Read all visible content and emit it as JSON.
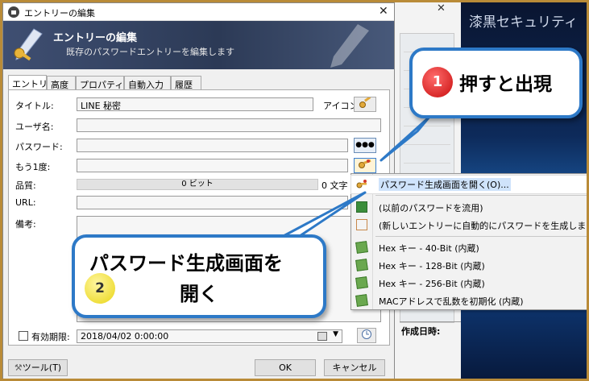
{
  "background_window": {
    "title": "漆黒セキュリティ",
    "close_glyph": "✕",
    "date_label": "作成日時:"
  },
  "dialog": {
    "title": "エントリーの編集",
    "close_glyph": "✕",
    "banner_title": "エントリーの編集",
    "banner_subtitle": "既存のパスワードエントリーを編集します",
    "tabs": [
      "エントリー",
      "高度",
      "プロパティ",
      "自動入力",
      "履歴"
    ],
    "fields": {
      "title_label": "タイトル:",
      "title_value": "LINE 秘密",
      "icon_label": "アイコン:",
      "username_label": "ユーザ名:",
      "username_value": "",
      "password_label": "パスワード:",
      "password_value": "",
      "reveal_glyph": "●●●",
      "repeat_label": "もう1度:",
      "repeat_value": "",
      "quality_label": "品質:",
      "quality_value": "0 ビット",
      "quality_chars": "0 文字",
      "url_label": "URL:",
      "url_value": "",
      "notes_label": "備考:",
      "expires_label": "有効期限:",
      "expires_value": "2018/04/02   0:00:00",
      "expires_checked": false
    },
    "buttons": {
      "tools": "ツール(T)",
      "ok": "OK",
      "cancel": "キャンセル"
    }
  },
  "generator_menu": {
    "items": [
      {
        "label": "パスワード生成画面を開く(O)...",
        "icon": "key-generate-icon",
        "highlighted": true
      },
      {
        "label": "(以前のパスワードを流用)",
        "icon": "history-icon",
        "highlighted": false
      },
      {
        "label": "(新しいエントリーに自動的にパスワードを生成します)",
        "icon": "auto-generate-icon",
        "highlighted": false
      },
      {
        "label": "Hex キー - 40-Bit (内蔵)",
        "icon": "profile-icon",
        "highlighted": false
      },
      {
        "label": "Hex キー - 128-Bit (内蔵)",
        "icon": "profile-icon",
        "highlighted": false
      },
      {
        "label": "Hex キー - 256-Bit (内蔵)",
        "icon": "profile-icon",
        "highlighted": false
      },
      {
        "label": "MACアドレスで乱数を初期化 (内蔵)",
        "icon": "profile-icon",
        "highlighted": false
      }
    ]
  },
  "callouts": {
    "one": {
      "number": "1",
      "text": "押すと出現"
    },
    "two": {
      "number": "2",
      "line1": "パスワード生成画面を",
      "line2": "開く"
    }
  },
  "colors": {
    "callout_border": "#2d79c7",
    "banner": "#2c3a56",
    "badge_red": "#c80d0d",
    "badge_yellow": "#e9d514",
    "frame": "#b98b38"
  }
}
